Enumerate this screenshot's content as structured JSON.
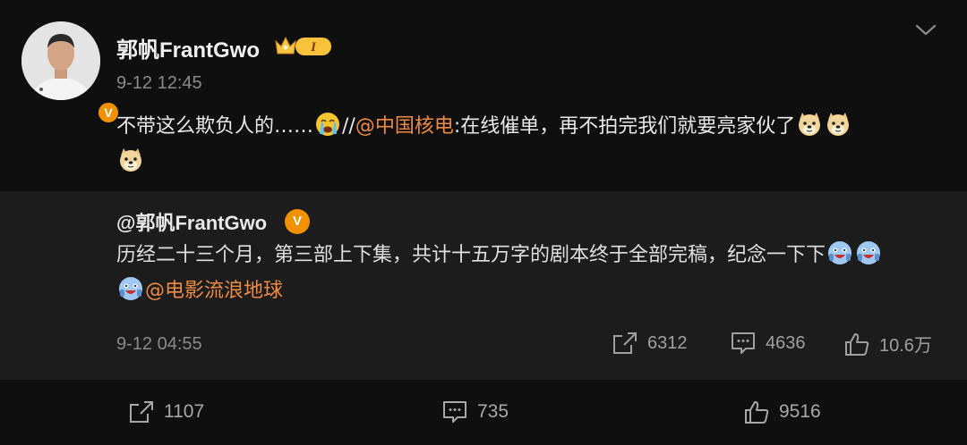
{
  "author": {
    "name": "郭帆FrantGwo",
    "verified_mark": "V",
    "level_badge": "I",
    "time": "9-12 12:45"
  },
  "post": {
    "text_before": "不带这么欺负人的……",
    "emoji_cry": "crying-face",
    "slashes": "//",
    "mention": "@中国核电",
    "text_after": ":在线催单，再不拍完我们就要亮家伙了",
    "emoji_doge": "doge"
  },
  "repost": {
    "user": "@郭帆FrantGwo",
    "verified_mark": "V",
    "text": "历经二十三个月，第三部上下集，共计十五万字的剧本终于全部完稿，纪念一下下",
    "emoji_cheer": "cheer",
    "mention": "@电影流浪地球",
    "time": "9-12 04:55",
    "shares": "6312",
    "comments": "4636",
    "likes": "10.6万"
  },
  "stats": {
    "shares": "1107",
    "comments": "735",
    "likes": "9516"
  },
  "colors": {
    "background": "#0f0f0f",
    "repost_background": "#1c1c1c",
    "mention": "#ee8a44",
    "verified": "#f29100"
  }
}
